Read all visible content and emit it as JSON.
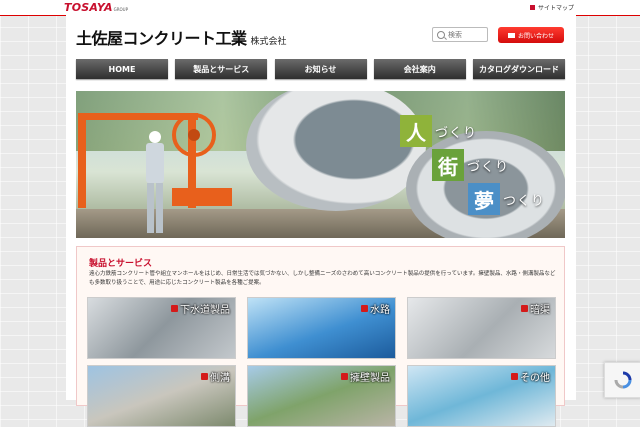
{
  "topbar": {
    "logo_main": "TOSAYA",
    "logo_sub": "GROUP",
    "sitemap_label": "サイトマップ"
  },
  "header": {
    "title_main": "土佐屋コンクリート工業",
    "title_sub": "株式会社",
    "search_placeholder": "検索",
    "contact_label": "お問い合わせ"
  },
  "nav": {
    "items": [
      {
        "label": "HOME"
      },
      {
        "label": "製品とサービス"
      },
      {
        "label": "お知らせ"
      },
      {
        "label": "会社案内"
      },
      {
        "label": "カタログダウンロード"
      }
    ]
  },
  "hero": {
    "slogans": [
      {
        "big": "人",
        "rest": "づくり",
        "color": "#8fb33a"
      },
      {
        "big": "街",
        "rest": "づくり",
        "color": "#6aa23b"
      },
      {
        "big": "夢",
        "rest": "つくり",
        "color": "#4b8fc7"
      }
    ]
  },
  "products": {
    "title": "製品とサービス",
    "description": "遠心力鉄筋コンクリート管や組立マンホールをはじめ、日常生活では気づかない、しかし整備ニーズのさわめて高いコンクリート製品の提供を行っています。擁壁製品、水路・側溝製品なども多数取り扱うことで、用途に応じたコンクリート製品を各種ご提案。",
    "cards": [
      {
        "label": "下水道製品"
      },
      {
        "label": "水路"
      },
      {
        "label": "暗渠"
      },
      {
        "label": "側溝"
      },
      {
        "label": "擁壁製品"
      },
      {
        "label": "その他"
      }
    ]
  },
  "colors": {
    "brand_red": "#c8102e",
    "nav_dark": "#2e2e2e"
  }
}
